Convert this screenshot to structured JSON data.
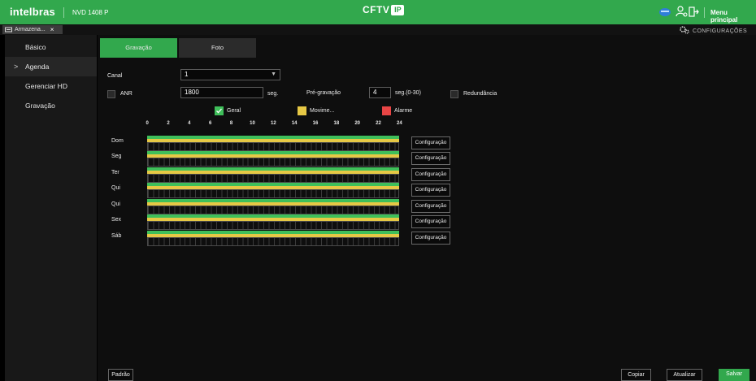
{
  "header": {
    "logo": "intelbras",
    "device_model": "NVD 1408 P",
    "brand_prefix": "CFTV",
    "brand_badge": "IP",
    "menu_principal": "Menu principal",
    "brand_color": "#32a84d",
    "icons": [
      "cloud-icon",
      "user-icon",
      "logout-icon"
    ]
  },
  "tabs": {
    "doc_tab_label": "Armazena...",
    "close_symbol": "×",
    "configuracoes": "CONFIGURAÇÕES"
  },
  "sidebar": {
    "items": [
      {
        "label": "Básico"
      },
      {
        "label": "Agenda",
        "expanded": true
      },
      {
        "label": "Gerenciar HD"
      },
      {
        "label": "Gravação"
      }
    ],
    "chevron": ">"
  },
  "subtabs": {
    "gravacao": "Gravação",
    "foto": "Foto"
  },
  "form": {
    "canal_label": "Canal",
    "canal_value": "1",
    "anr_label": "ANR",
    "anr_value": "1800",
    "seg_label": "seg.",
    "pregravacao_label": "Pré-gravação",
    "pregravacao_value": "4",
    "pregravacao_unit": "seg.(0-30)",
    "redundancia_label": "Redundância"
  },
  "legend": {
    "geral": "Geral",
    "movimento": "Movime...",
    "alarme": "Alarme",
    "colors": {
      "geral": "#3fbf5a",
      "movimento": "#e6c845",
      "alarme": "#e84545"
    }
  },
  "schedule": {
    "hours": [
      "0",
      "2",
      "4",
      "6",
      "8",
      "10",
      "12",
      "14",
      "16",
      "18",
      "20",
      "22",
      "24"
    ],
    "days": [
      {
        "label": "Dom",
        "button": "Configuração"
      },
      {
        "label": "Seg",
        "button": "Configuração"
      },
      {
        "label": "Ter",
        "button": "Configuração"
      },
      {
        "label": "Qui",
        "button": "Configuração"
      },
      {
        "label": "Qui",
        "button": "Configuração"
      },
      {
        "label": "Sex",
        "button": "Configuração"
      },
      {
        "label": "Sáb",
        "button": "Configuração"
      }
    ]
  },
  "footer": {
    "padrao": "Padrão",
    "copiar": "Copiar",
    "atualizar": "Atualizar",
    "salvar": "Salvar"
  }
}
